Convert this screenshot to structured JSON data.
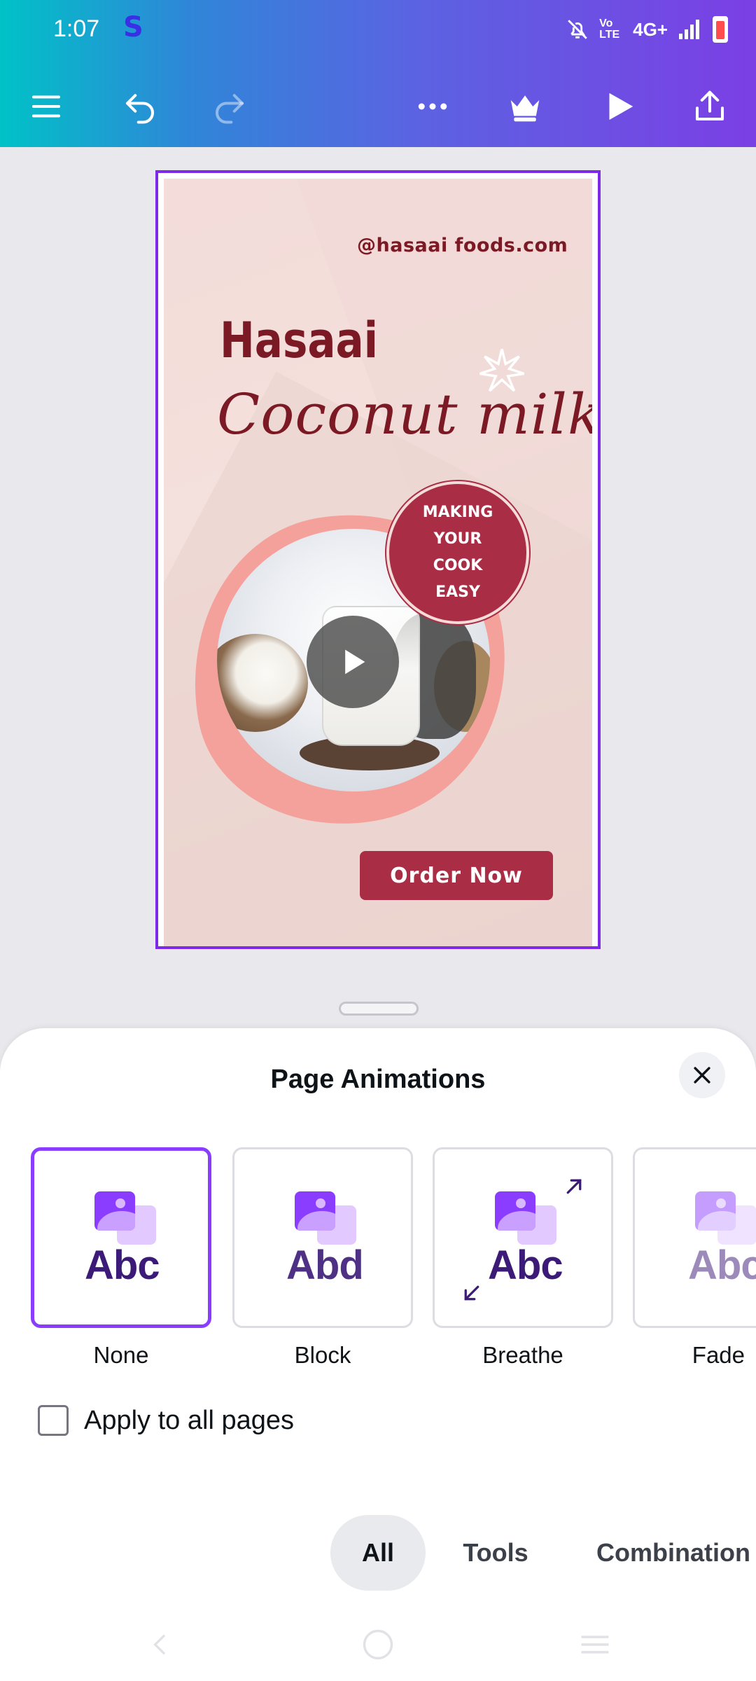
{
  "status_bar": {
    "time": "1:07",
    "app_badge": "S",
    "network_text": "4G+",
    "volte_text": "Vo LTE"
  },
  "toolbar": {
    "menu_icon": "hamburger-menu-icon",
    "undo_icon": "undo-icon",
    "redo_icon": "redo-icon",
    "more_icon": "more-dots-icon",
    "premium_icon": "crown-icon",
    "play_icon": "play-icon",
    "share_icon": "share-icon"
  },
  "design": {
    "handle": "@hasaai foods.com",
    "brand": "Hasaai",
    "product": "Coconut milk",
    "badge_lines": [
      "MAKING",
      "YOUR",
      "COOK",
      "EASY"
    ],
    "cta": "Order Now"
  },
  "sheet": {
    "title": "Page Animations",
    "animations": [
      {
        "label": "None",
        "selected": true
      },
      {
        "label": "Block",
        "selected": false
      },
      {
        "label": "Breathe",
        "selected": false
      },
      {
        "label": "Fade",
        "selected": false
      }
    ],
    "thumb_text": "Abc",
    "thumb_text_block": "Abd",
    "apply_all_label": "Apply to all pages",
    "apply_all_checked": false,
    "filter_tabs": [
      {
        "label": "All",
        "active": true
      },
      {
        "label": "Tools",
        "active": false
      },
      {
        "label": "Combination",
        "active": false
      }
    ]
  },
  "colors": {
    "accent": "#8b3dff",
    "brand_maroon": "#7b1a24",
    "badge_red": "#a92d45"
  }
}
